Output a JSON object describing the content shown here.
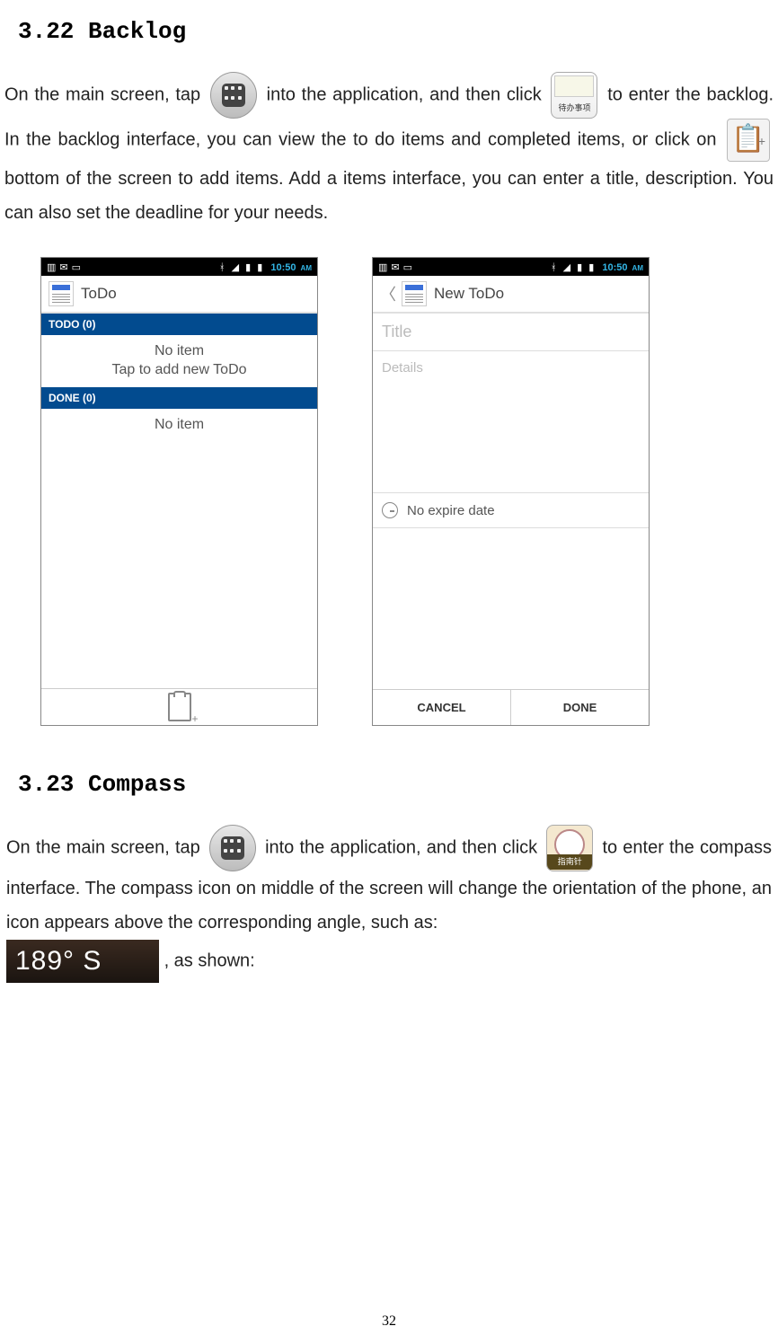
{
  "section1": {
    "heading": "3.22 Backlog",
    "text": {
      "p1_a": "On the main screen, tap ",
      "p1_b": " into the application, and then click ",
      "p1_c": " to enter the backlog. In the backlog interface, you can view the to do items and completed items, or click on ",
      "p1_d": " bottom of the screen to add items. Add a items interface, you can enter a title, description. You can also set the deadline for your needs."
    },
    "todo_label": "待办事项"
  },
  "screenshot_common": {
    "time": "10:50",
    "ampm": "AM"
  },
  "screenshot1": {
    "title": "ToDo",
    "todo_header": "TODO (0)",
    "empty_line1": "No item",
    "empty_line2": "Tap to add new ToDo",
    "done_header": "DONE (0)",
    "done_empty": "No item"
  },
  "screenshot2": {
    "title": "New ToDo",
    "title_hint": "Title",
    "details_hint": "Details",
    "expire": "No expire date",
    "cancel": "CANCEL",
    "done": "DONE"
  },
  "section2": {
    "heading": "3.23 Compass",
    "text": {
      "p1_a": "On the main screen, tap ",
      "p1_b": " into the application, and then click ",
      "p1_c": " to enter the compass interface. The compass icon on middle of the screen will change the orientation of the phone, an icon appears above the corresponding angle, such as: ",
      "p1_d": ", as shown:"
    },
    "compass_label": "指南针",
    "degree": "189° S"
  },
  "page_number": "32"
}
